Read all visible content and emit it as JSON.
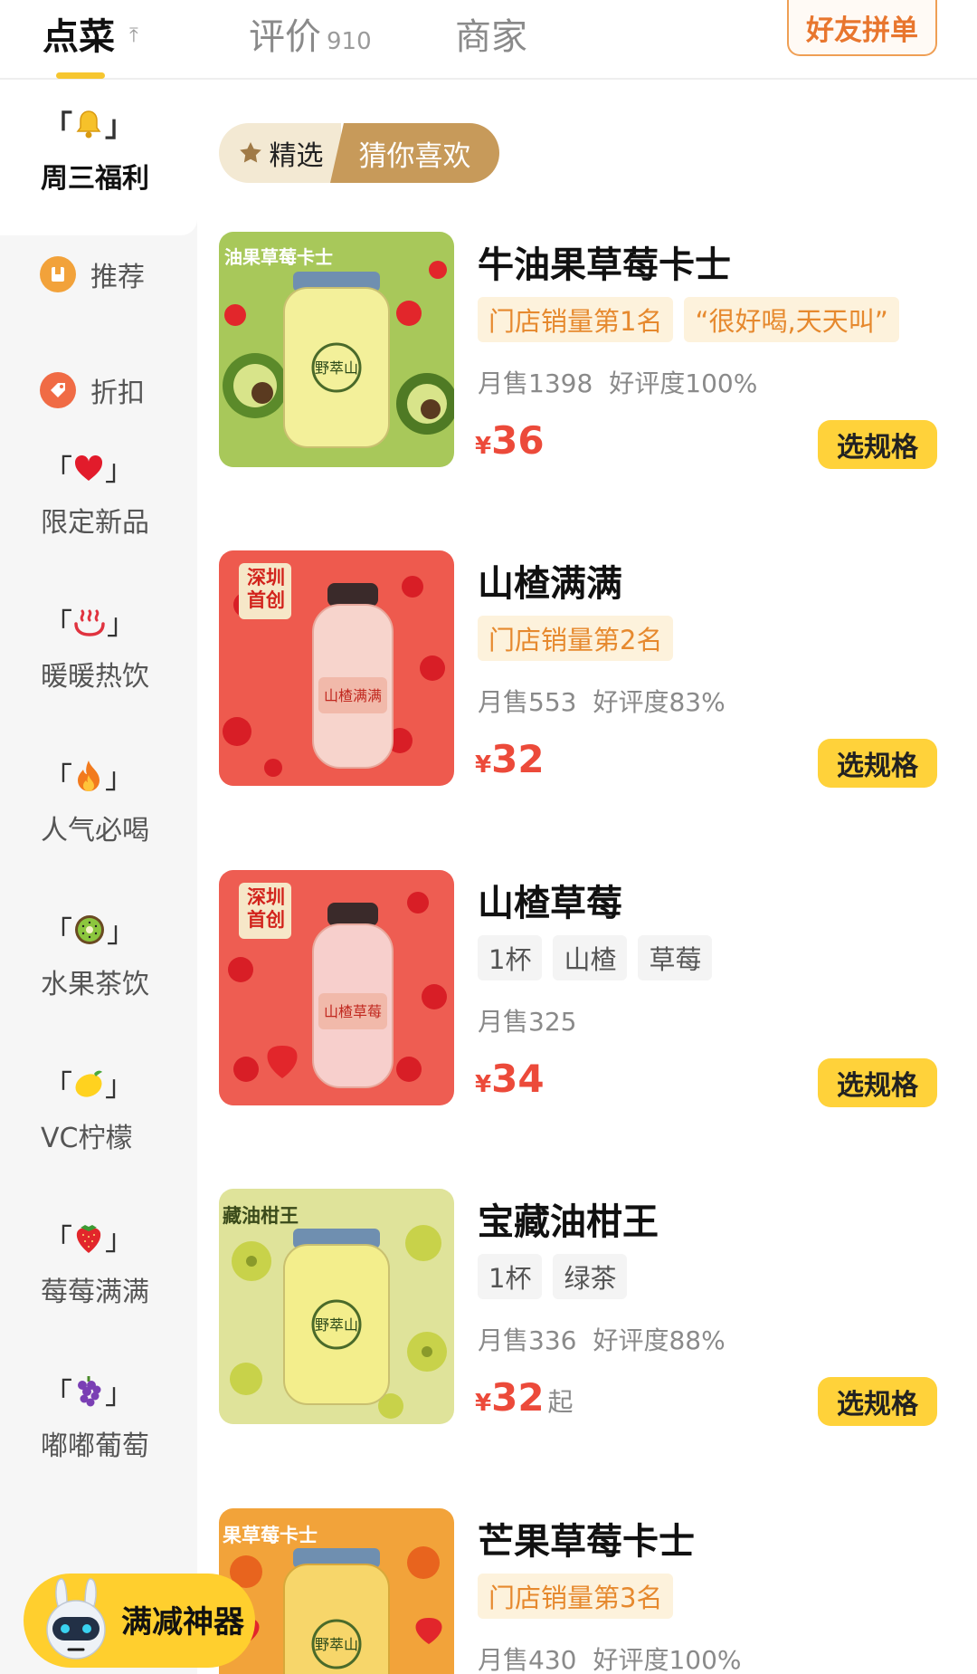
{
  "tabs": {
    "order": "点菜",
    "reviews": "评价",
    "reviews_count": "910",
    "shop": "商家",
    "group_order": "好友拼单"
  },
  "colors": {
    "accent_yellow": "#ffd23a",
    "price_red": "#ec4a3a",
    "rank_orange": "#e6892e"
  },
  "sidebar": {
    "items": [
      {
        "label": "周三福利",
        "icon": "bell-icon"
      },
      {
        "label": "推荐",
        "icon": "recommend-icon"
      },
      {
        "label": "折扣",
        "icon": "discount-tag-icon"
      },
      {
        "label": "限定新品",
        "icon": "heart-icon"
      },
      {
        "label": "暖暖热饮",
        "icon": "hot-springs-icon"
      },
      {
        "label": "人气必喝",
        "icon": "fire-icon"
      },
      {
        "label": "水果茶饮",
        "icon": "kiwi-icon"
      },
      {
        "label": "VC柠檬",
        "icon": "lemon-icon"
      },
      {
        "label": "莓莓满满",
        "icon": "strawberry-icon"
      },
      {
        "label": "嘟嘟葡萄",
        "icon": "grape-icon"
      }
    ]
  },
  "subtabs": {
    "featured": "精选",
    "guess": "猜你喜欢"
  },
  "products": [
    {
      "name": "牛油果草莓卡士",
      "tags": [
        "门店销量第1名",
        "“很好喝,天天叫”"
      ],
      "sales": "月售1398",
      "rating": "好评度100%",
      "price_symbol": "¥",
      "price": "36",
      "button": "选规格",
      "image_text": "油果草莓卡士"
    },
    {
      "name": "山楂满满",
      "tags": [
        "门店销量第2名"
      ],
      "sales": "月售553",
      "rating": "好评度83%",
      "price_symbol": "¥",
      "price": "32",
      "button": "选规格",
      "image_text": "深圳首创"
    },
    {
      "name": "山楂草莓",
      "tags": [
        "1杯",
        "山楂",
        "草莓"
      ],
      "sales": "月售325",
      "price_symbol": "¥",
      "price": "34",
      "button": "选规格",
      "image_text": "深圳首创"
    },
    {
      "name": "宝藏油柑王",
      "tags": [
        "1杯",
        "绿茶"
      ],
      "sales": "月售336",
      "rating": "好评度88%",
      "price_symbol": "¥",
      "price": "32",
      "price_suffix": "起",
      "button": "选规格",
      "image_text": "藏油柑王"
    },
    {
      "name": "芒果草莓卡士",
      "tags": [
        "门店销量第3名"
      ],
      "sales": "月售430",
      "rating": "好评度100%",
      "image_text": "果草莓卡士"
    }
  ],
  "floating": {
    "label": "满减神器"
  }
}
